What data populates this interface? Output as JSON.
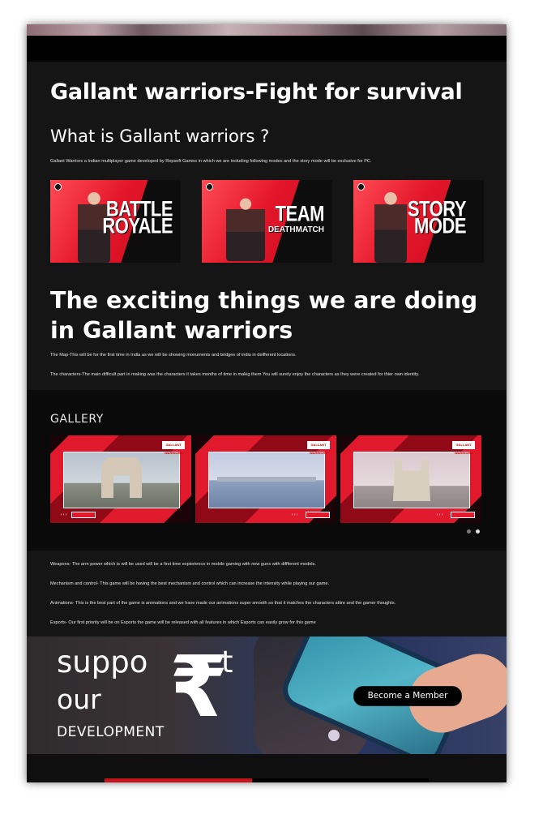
{
  "header": {
    "title": "Gallant warriors-Fight for survival",
    "subtitle": "What is Gallant warriors ?",
    "intro": "Gallant Warriors a Indian multiplayer game developed by Repsoft Games in which we are including following modes and the story mode will be exclusive for PC."
  },
  "modes": [
    {
      "title": "BATTLE",
      "title2": "ROYALE",
      "sub": ""
    },
    {
      "title": "TEAM",
      "title2": "",
      "sub": "DEATHMATCH"
    },
    {
      "title": "STORY",
      "title2": "MODE",
      "sub": ""
    }
  ],
  "features": {
    "heading": "The exciting things we are doing in Gallant warriors",
    "map": "The Map-This will be for the first time in India as we will be showing monuments and bridges of india in deifferent locations.",
    "characters": "The characters-The main difficult part in making was the characters it takes months of time in makig them You will surely enjoy the characters as they were created for thier own identity."
  },
  "gallery": {
    "title": "GALLERY",
    "slides": [
      {
        "logo": "GALLANT WARRIORS"
      },
      {
        "logo": "GALLANT WARRIORS"
      },
      {
        "logo": "GALLANT WARRIORS"
      }
    ]
  },
  "more": {
    "weapons": "Weapons- The arm power which is will be used will be a first time expierience in mobile gaming with new guns with diffferent models.",
    "mechanism": "Mechanism and control- This game will be having the best mechanism and control which can increase the intensity while playing our game.",
    "animations": "Animations- This is the best part of the game is animations and we have made our animations super smooth so that it matches the characters attire and the gamer thoughts.",
    "esports": "Esports- Our first priority will be on Esports the game will be released with all features in which Esports can easily grow for this game"
  },
  "support": {
    "word1a": "suppo",
    "word1b": "t",
    "word2": "our",
    "word3": "DEVELOPMENT",
    "rupee": "₹",
    "button": "Become a Member"
  },
  "colors": {
    "accent_red": "#c4151f",
    "page_bg": "#151515"
  }
}
